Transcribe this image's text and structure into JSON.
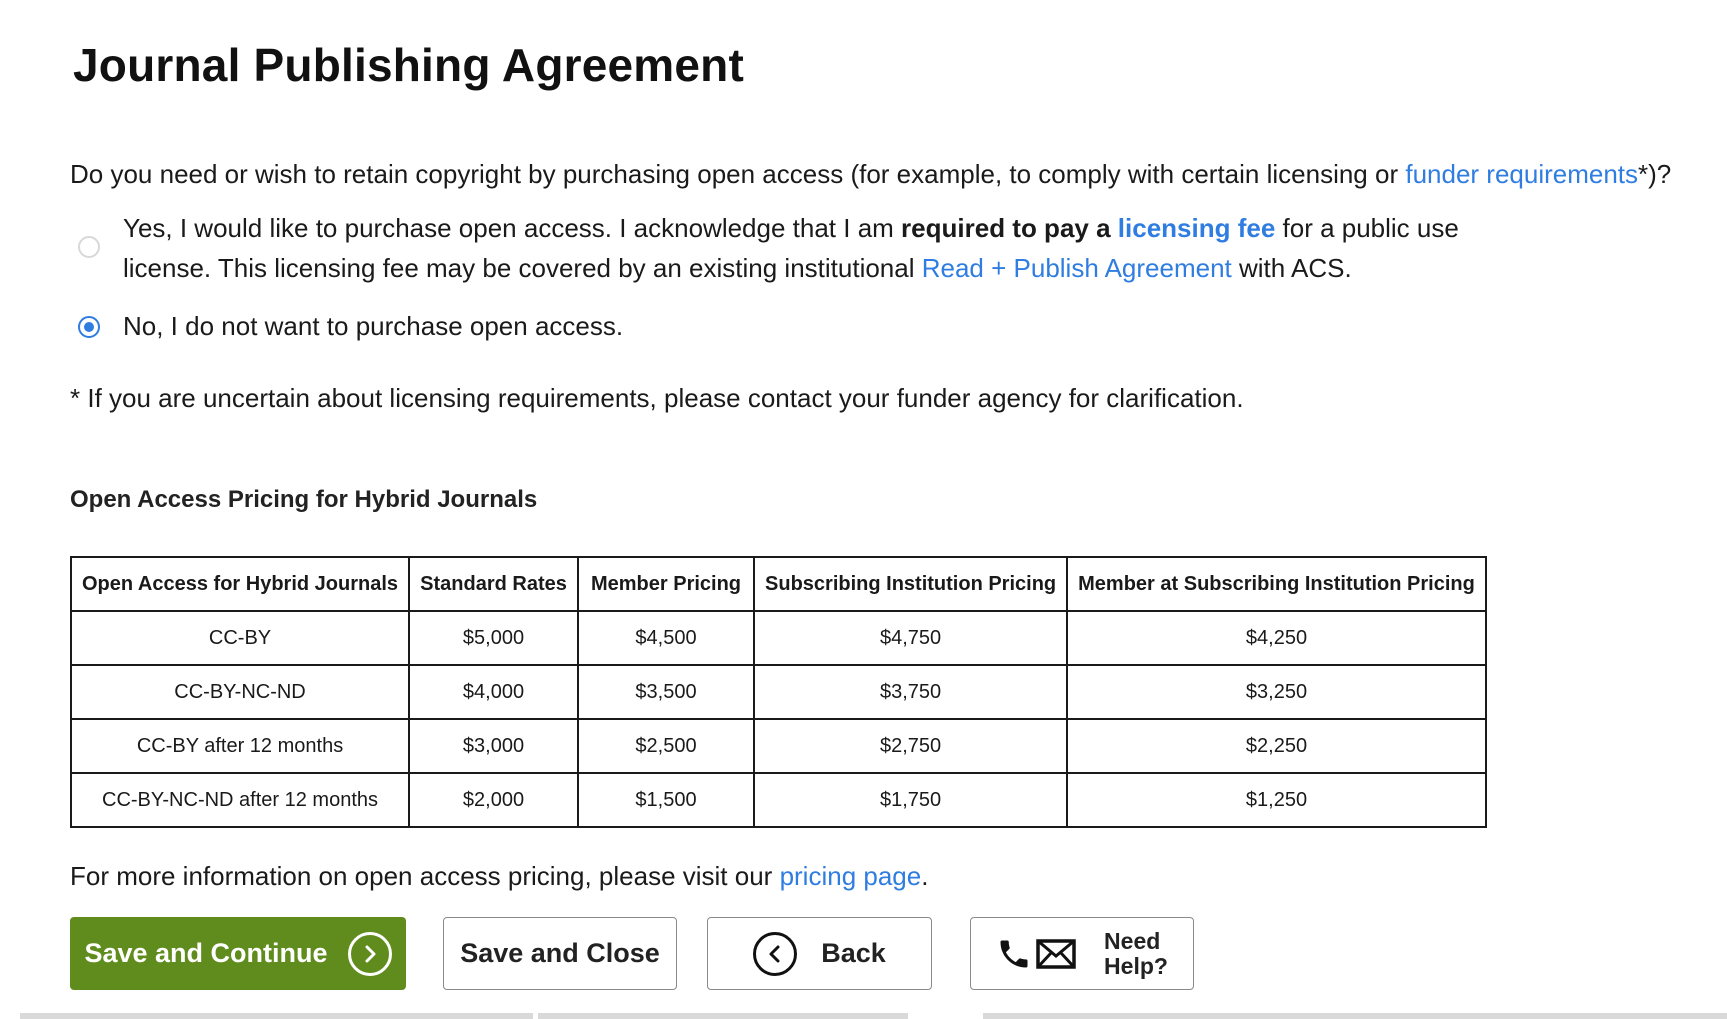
{
  "page": {
    "title": "Journal Publishing Agreement"
  },
  "question": {
    "text": "Do you need or wish to retain copyright by purchasing open access (for example, to comply with certain licensing or ",
    "link": "funder requirements",
    "suffix": "*)?"
  },
  "options": [
    {
      "part1": "Yes, I would like to purchase open access. I acknowledge that I am ",
      "bold": "required to pay a",
      "part2": " ",
      "link1": "licensing fee",
      "part3": " for a public use license. This licensing fee may be covered by an existing institutional ",
      "link2": "Read + Publish Agreement",
      "part4": " with ACS.",
      "selected": false
    },
    {
      "label": "No, I do not want to purchase open access.",
      "selected": true
    }
  ],
  "note": "* If you are uncertain about licensing requirements, please contact your funder agency for clarification.",
  "pricing_table": {
    "title": "Open Access Pricing for Hybrid Journals",
    "headers": [
      "Open Access for Hybrid Journals",
      "Standard Rates",
      "Member Pricing",
      "Subscribing Institution Pricing",
      "Member at Subscribing Institution Pricing"
    ],
    "rows": [
      [
        "CC-BY",
        "$5,000",
        "$4,500",
        "$4,750",
        "$4,250"
      ],
      [
        "CC-BY-NC-ND",
        "$4,000",
        "$3,500",
        "$3,750",
        "$3,250"
      ],
      [
        "CC-BY after 12 months",
        "$3,000",
        "$2,500",
        "$2,750",
        "$2,250"
      ],
      [
        "CC-BY-NC-ND after 12 months",
        "$2,000",
        "$1,500",
        "$1,750",
        "$1,250"
      ]
    ]
  },
  "more_info": {
    "text": "For more information on open access pricing, please visit our ",
    "link": "pricing page",
    "suffix": "."
  },
  "buttons": {
    "save_continue": "Save and Continue",
    "save_close": "Save and Close",
    "back": "Back",
    "help_line1": "Need",
    "help_line2": "Help?"
  },
  "icons": {
    "save_continue": "chevron-right-circle-icon",
    "back": "chevron-left-circle-icon",
    "help_phone": "phone-icon",
    "help_mail": "envelope-icon"
  },
  "colors": {
    "primary_button": "#5f8c1c",
    "link": "#2f7de1",
    "radio_selected": "#2f7de1"
  }
}
